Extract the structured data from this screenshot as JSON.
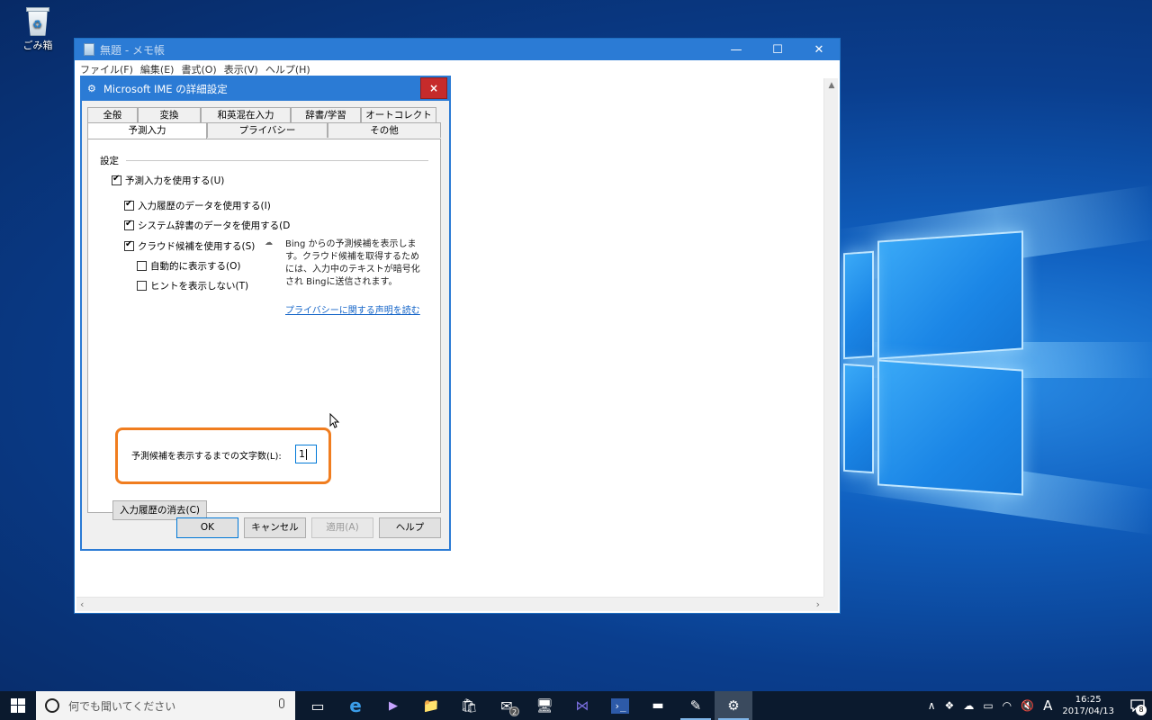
{
  "desktop": {
    "icons": [
      {
        "label": "ごみ箱",
        "icon": "recycle-bin-icon"
      }
    ]
  },
  "notepad": {
    "title": "無題 - メモ帳",
    "controls": {
      "minimize": "—",
      "maximize": "☐",
      "close": "✕"
    },
    "menu": [
      "ファイル(F)",
      "編集(E)",
      "書式(O)",
      "表示(V)",
      "ヘルプ(H)"
    ]
  },
  "dialog": {
    "title": "Microsoft IME の詳細設定",
    "close": "×",
    "tabs_row1": [
      "全般",
      "変換",
      "和英混在入力",
      "辞書/学習",
      "オートコレクト"
    ],
    "tabs_row2": [
      "予測入力",
      "プライバシー",
      "その他"
    ],
    "active_tab": "予測入力",
    "group_label": "設定",
    "options": {
      "use_prediction": {
        "label": "予測入力を使用する(U)",
        "checked": true
      },
      "use_history": {
        "label": "入力履歴のデータを使用する(I)",
        "checked": true
      },
      "use_system_dict": {
        "label": "システム辞書のデータを使用する(D",
        "checked": true
      },
      "use_cloud": {
        "label": "クラウド候補を使用する(S)",
        "checked": true
      },
      "auto_show": {
        "label": "自動的に表示する(O)",
        "checked": false
      },
      "no_hint": {
        "label": "ヒントを表示しない(T)",
        "checked": false
      }
    },
    "cloud_info": "Bing からの予測候補を表示します。クラウド候補を取得するためには、入力中のテキストが暗号化され Bingに送信されます。",
    "privacy_link": "プライバシーに関する声明を読む",
    "char_count_label": "予測候補を表示するまでの文字数(L):",
    "char_count_value": "1",
    "clear_history_button": "入力履歴の消去(C)",
    "buttons": {
      "ok": "OK",
      "cancel": "キャンセル",
      "apply": "適用(A)",
      "help": "ヘルプ"
    }
  },
  "taskbar": {
    "search_placeholder": "何でも聞いてください",
    "apps": [
      {
        "name": "task-view",
        "glyph": "▭"
      },
      {
        "name": "edge",
        "glyph": "e"
      },
      {
        "name": "paint3d",
        "glyph": "▶"
      },
      {
        "name": "file-explorer",
        "glyph": "📁"
      },
      {
        "name": "store",
        "glyph": "🛍"
      },
      {
        "name": "mail",
        "glyph": "✉",
        "badge": "2"
      },
      {
        "name": "remote-desktop",
        "glyph": "🖥"
      },
      {
        "name": "visual-studio",
        "glyph": "⋈"
      },
      {
        "name": "powershell",
        "glyph": "›_"
      },
      {
        "name": "command-prompt",
        "glyph": "▬"
      },
      {
        "name": "notepad",
        "glyph": "✎"
      },
      {
        "name": "ime-settings",
        "glyph": "⚙"
      }
    ],
    "tray": {
      "chevron": "∧",
      "ime_mode": "A",
      "time": "16:25",
      "date": "2017/04/13",
      "notifications": "8"
    }
  }
}
